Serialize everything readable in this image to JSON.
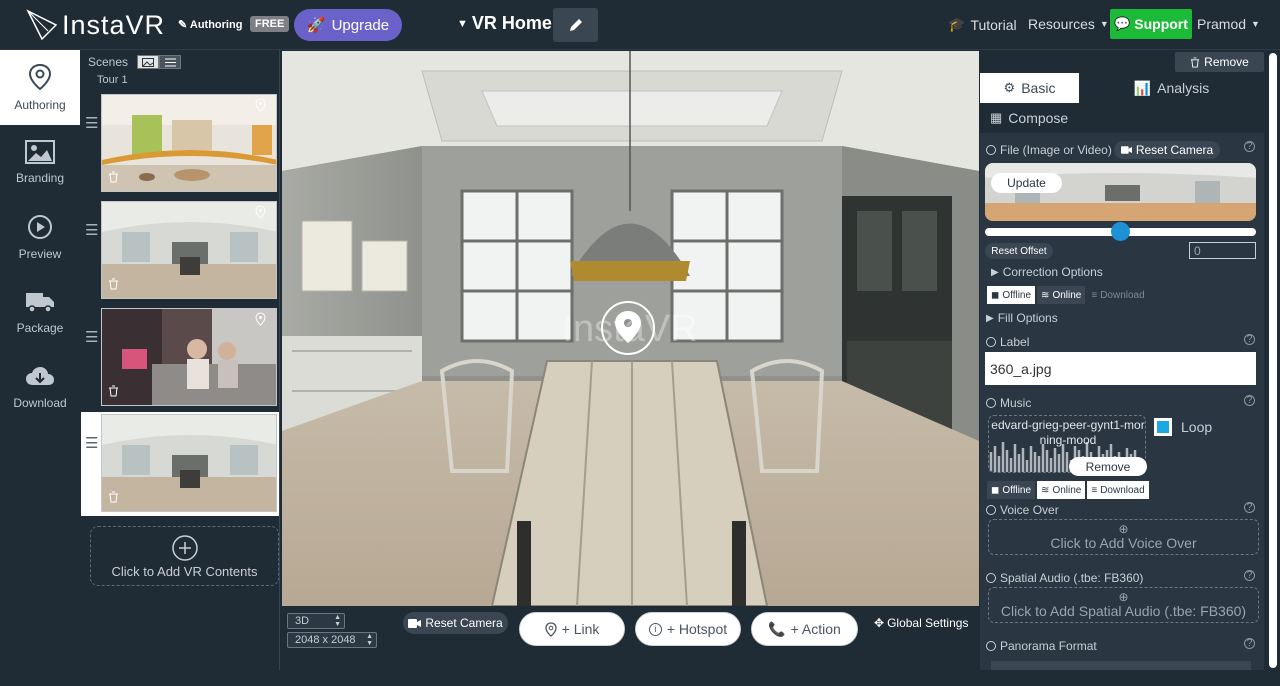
{
  "header": {
    "logo_text": "InstaVR",
    "authoring_tag": "Authoring",
    "free_badge": "FREE",
    "upgrade_label": "Upgrade",
    "project_title": "VR Home",
    "tutorial": "Tutorial",
    "resources": "Resources",
    "support": "Support",
    "user": "Pramod"
  },
  "sidebar": {
    "items": [
      {
        "label": "Authoring",
        "icon": "map-pin-icon"
      },
      {
        "label": "Branding",
        "icon": "image-icon"
      },
      {
        "label": "Preview",
        "icon": "play-circle-icon"
      },
      {
        "label": "Package",
        "icon": "truck-icon"
      },
      {
        "label": "Download",
        "icon": "cloud-download-icon"
      }
    ]
  },
  "scenes": {
    "header": "Scenes",
    "tour": "Tour 1",
    "add_label": "Click to Add VR Contents"
  },
  "viewport": {
    "watermark": "InstaVR"
  },
  "bottombar": {
    "mode": "3D",
    "resolution": "2048 x 2048",
    "reset_camera": "Reset Camera",
    "link": "+ Link",
    "hotspot": "+ Hotspot",
    "action": "+ Action",
    "global_settings": "Global Settings"
  },
  "panel": {
    "remove_label": "Remove",
    "tab_basic": "Basic",
    "tab_analysis": "Analysis",
    "tab_compose": "Compose",
    "file_label": "File (Image or Video)",
    "reset_camera": "Reset Camera",
    "update": "Update",
    "reset_offset": "Reset Offset",
    "offset_value": "0",
    "correction_options": "Correction Options",
    "offline": "Offline",
    "online": "Online",
    "download": "Download",
    "fill_options": "Fill Options",
    "label_title": "Label",
    "label_value": "360_a.jpg",
    "music_title": "Music",
    "music_file": "edvard-grieg-peer-gynt1-morning-mood",
    "music_remove": "Remove",
    "loop": "Loop",
    "voice_over": "Voice Over",
    "add_voice_over": "Click to Add Voice Over",
    "spatial_audio": "Spatial Audio (.tbe: FB360)",
    "add_spatial": "Click to Add Spatial Audio (.tbe: FB360)",
    "panorama_format": "Panorama Format"
  }
}
